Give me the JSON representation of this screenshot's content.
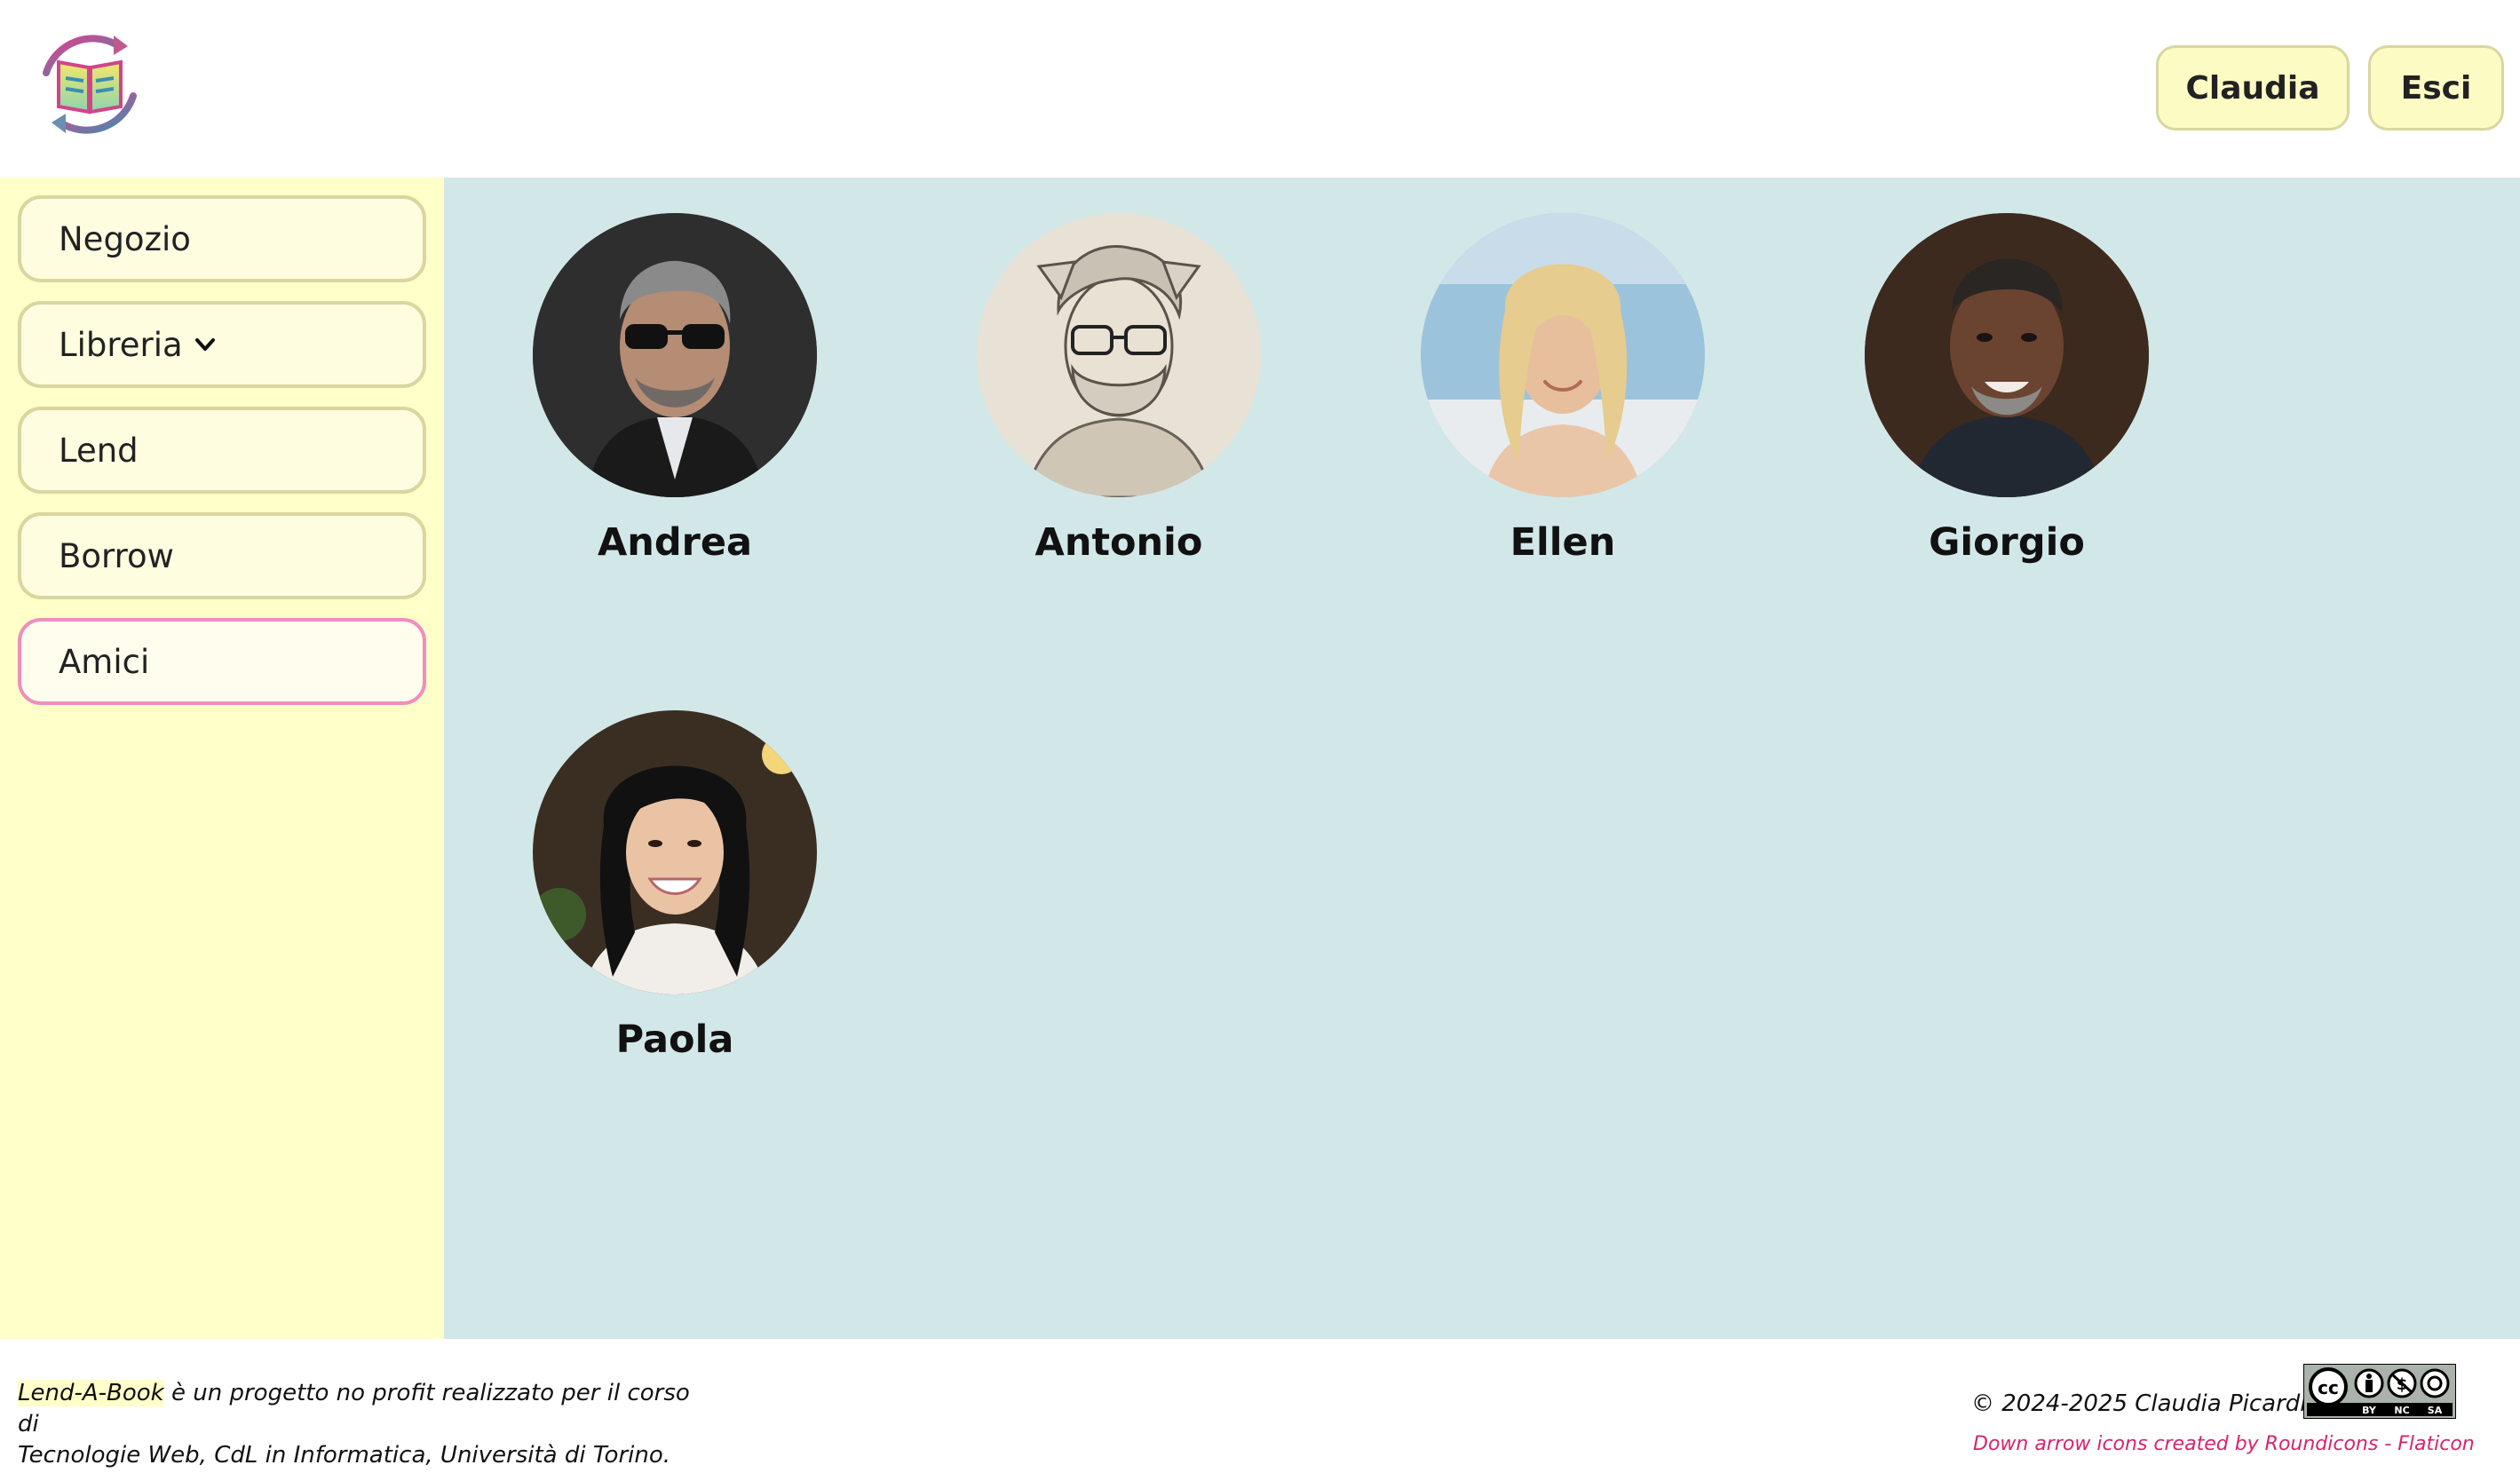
{
  "header": {
    "logo_name": "book-exchange-logo",
    "user_button": "Claudia",
    "exit_button": "Esci"
  },
  "sidebar": {
    "items": [
      {
        "label": "Negozio"
      },
      {
        "label": "Libreria",
        "has_dropdown": true,
        "icon": "chevron-down-icon"
      },
      {
        "label": "Lend"
      },
      {
        "label": "Borrow"
      },
      {
        "label": "Amici",
        "active": true
      }
    ]
  },
  "friends": [
    {
      "name": "Andrea"
    },
    {
      "name": "Antonio"
    },
    {
      "name": "Ellen"
    },
    {
      "name": "Giorgio"
    },
    {
      "name": "Paola"
    }
  ],
  "footer": {
    "brand": "Lend-A-Book",
    "description_line1": " è un progetto no profit realizzato per il corso di",
    "description_line2": "Tecnologie Web, CdL in Informatica, Università di Torino.",
    "copyright": "© 2024-2025 Claudia Picardi.",
    "license_badge": {
      "labels": [
        "BY",
        "NC",
        "SA"
      ],
      "icon": "creative-commons-icon"
    },
    "attribution": "Down arrow icons created by Roundicons - Flaticon"
  },
  "colors": {
    "sidebar_bg": "#feffc9",
    "main_bg": "#d2e7e8",
    "button_bg": "#fdfbc4",
    "active_border": "#ef8fbc",
    "link_pink": "#d6246e"
  }
}
